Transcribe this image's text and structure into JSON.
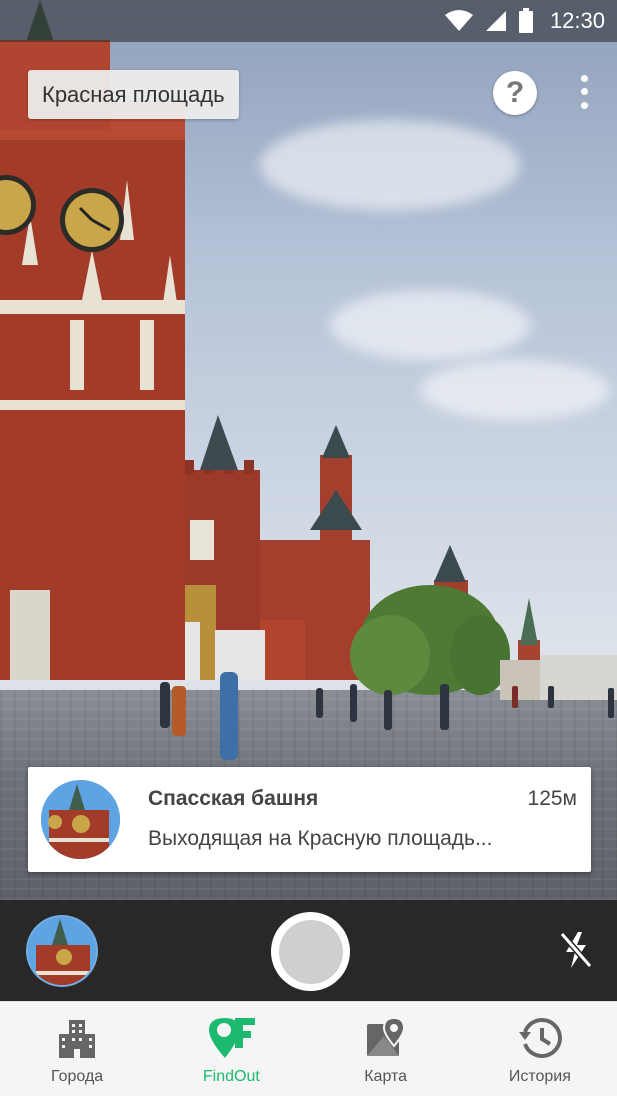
{
  "status_bar": {
    "time": "12:30"
  },
  "location_chip": {
    "label": "Красная площадь"
  },
  "help_button": {
    "label": "?"
  },
  "info_card": {
    "title": "Спасская башня",
    "distance": "125м",
    "description": "Выходящая на Красную площадь..."
  },
  "bottom_nav": {
    "items": [
      {
        "label": "Города",
        "icon": "city-buildings-icon"
      },
      {
        "label": "FindOut",
        "icon": "findout-logo-icon",
        "active": true
      },
      {
        "label": "Карта",
        "icon": "map-pin-icon"
      },
      {
        "label": "История",
        "icon": "history-clock-icon"
      }
    ]
  },
  "colors": {
    "accent": "#1db96e",
    "nav_bg": "#f5f5f5",
    "camera_bar": "#282828",
    "icon_gray": "#666666"
  }
}
